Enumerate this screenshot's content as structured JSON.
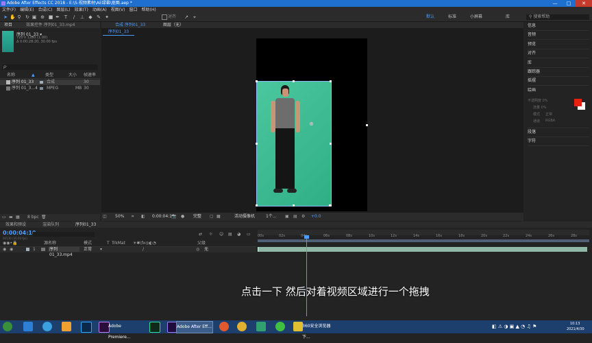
{
  "window": {
    "title": "Adobe After Effects CC 2018 - E:\\S-视频素材\\AE绿幕\\抠图.aep *",
    "min": "—",
    "max": "□",
    "close": "✕"
  },
  "menu": [
    "文件(F)",
    "编辑(E)",
    "合成(C)",
    "图层(L)",
    "效果(T)",
    "动画(A)",
    "视图(V)",
    "窗口",
    "帮助(H)"
  ],
  "toolbar": {
    "align_label": "对齐",
    "workspaces": [
      "默认",
      "标准",
      "小屏幕",
      "库"
    ],
    "search_label": "搜索帮助"
  },
  "project": {
    "tab": "项目",
    "effects_tab": "效果控件 序列01_33.mp4",
    "item_title": "序列 01_33 ▾",
    "item_info1": "720 x 1280 (1.00)",
    "item_info2": "Δ 0:00:28:20, 30.00 fps",
    "search_placeholder": "ρ·",
    "columns": [
      "名称",
      "类型",
      "大小",
      "帧速率"
    ],
    "rows": [
      {
        "name": "序列 01_33",
        "type": "合成",
        "size": "",
        "fps": "30"
      },
      {
        "name": "序列 01_3...4",
        "type": "MPEG",
        "size": "MB",
        "fps": "30"
      }
    ],
    "footer": "8 bpc"
  },
  "comp": {
    "tab": "合成 序列01_33",
    "layer_tab": "图层（无）",
    "subtab": "序列01_33",
    "zoom": "50%",
    "time": "0:00:04:10",
    "quality": "完整",
    "camera": "活动摄像机",
    "views": "1个...",
    "exposure": "+0.0"
  },
  "right_panel": {
    "items": [
      "信息",
      "音频",
      "预览",
      "对齐",
      "库",
      "跟踪器",
      "摇摆",
      "绘画",
      "段落",
      "字符"
    ],
    "paint": {
      "opacity": "不透明度 0%",
      "flow": "流量 0%",
      "mode_label": "模式",
      "mode_value": "正常",
      "channel_label": "通道",
      "channel_value": "RGBA"
    },
    "fg_color": "#e82010"
  },
  "timeline": {
    "tabs": [
      "效果和预设",
      "渲染队列",
      "序列01_33"
    ],
    "timecode": "0:00:04:10",
    "frames": "00130 (30.00 fps)",
    "columns": [
      "源名称",
      "模式",
      "T",
      "TrkMat",
      "父级"
    ],
    "layer": {
      "num": "1",
      "name": "序列 01_33.mp4",
      "mode": "正常",
      "parent": "无"
    },
    "ruler": [
      "00s",
      "02s",
      "04s",
      "06s",
      "08s",
      "10s",
      "12s",
      "14s",
      "16s",
      "18s",
      "20s",
      "22s",
      "24s",
      "26s",
      "28s"
    ]
  },
  "subtitle": "点击一下 然后对着视频区域进行一个拖拽",
  "taskbar": {
    "buttons": [
      "Adobe Premiere...",
      "Adobe After Eff...",
      "360安全浏览器下..."
    ],
    "clock_time": "10:13",
    "clock_date": "2021/4/30"
  }
}
